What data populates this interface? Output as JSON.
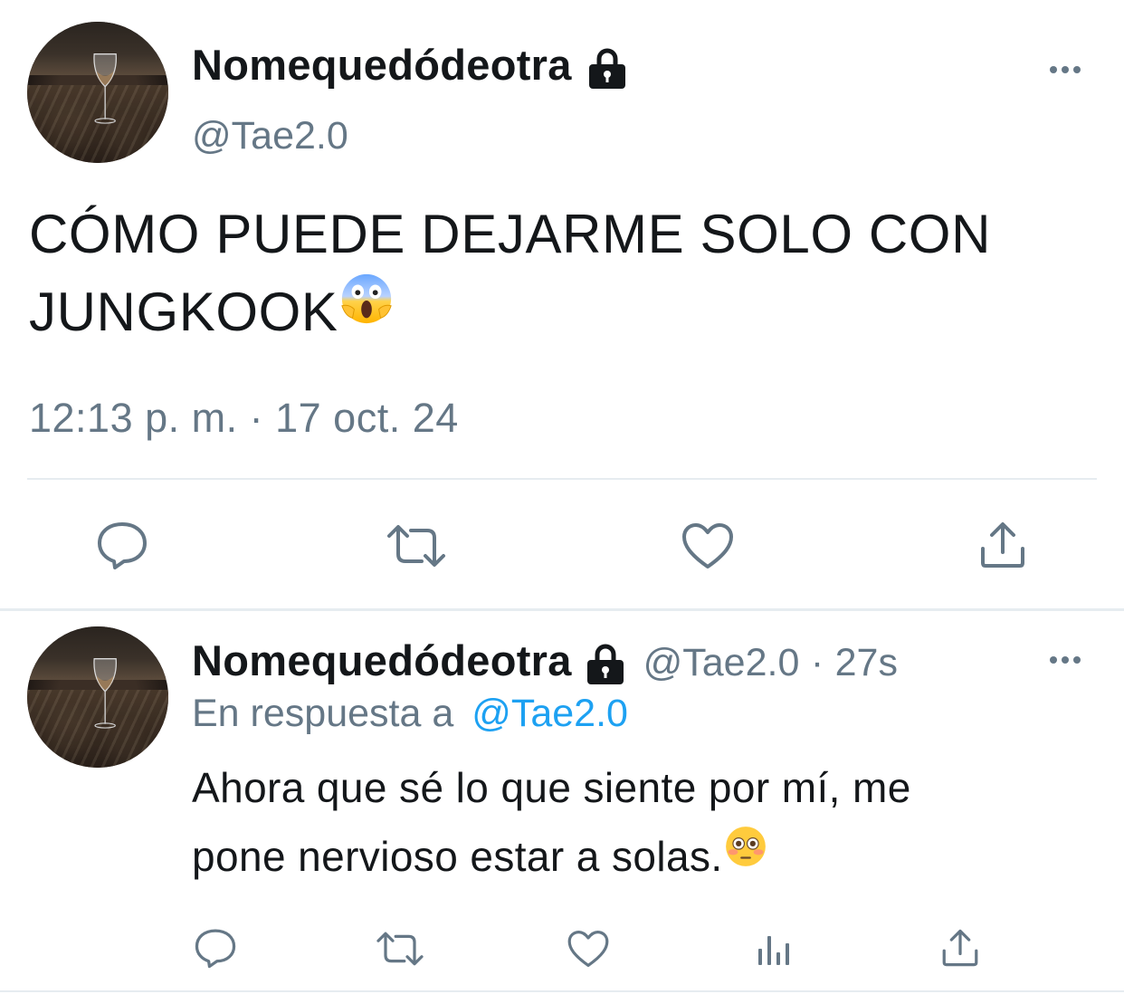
{
  "main_tweet": {
    "display_name": "Nomequedódeotra",
    "handle": "@Tae2.0",
    "text_line1": "CÓMO PUEDE DEJARME SOLO CON",
    "text_line2": "JUNGKOOK",
    "emoji": "face-screaming-in-fear",
    "timestamp": "12:13 p. m. · 17 oct. 24",
    "actions": [
      "reply-icon",
      "retweet-icon",
      "like-icon",
      "share-icon"
    ]
  },
  "reply_tweet": {
    "display_name": "Nomequedódeotra",
    "handle": "@Tae2.0",
    "separator": "·",
    "time_ago": "27s",
    "in_reply_prefix": "En respuesta a",
    "in_reply_handle": "@Tae2.0",
    "text_line1": "Ahora que sé lo que siente por mí, me",
    "text_line2": "pone nervioso estar a solas.",
    "emoji": "flushed-face",
    "actions": [
      "reply-icon",
      "retweet-icon",
      "like-icon",
      "analytics-icon",
      "share-icon"
    ]
  },
  "colors": {
    "text": "#14171a",
    "secondary": "#657786",
    "link": "#1da1f2",
    "divider": "#e6ecf0"
  }
}
